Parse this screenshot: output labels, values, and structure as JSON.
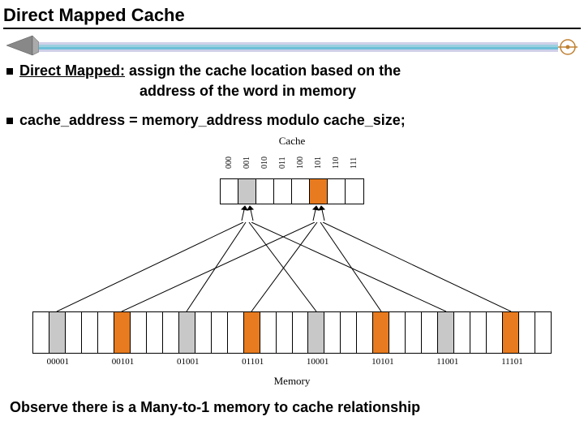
{
  "title": "Direct Mapped Cache",
  "bullets": {
    "b1_lead": "Direct Mapped:",
    "b1_rest": "  assign the cache location based on the",
    "b1_cont": "address of the word in memory",
    "b2": "cache_address =  memory_address modulo  cache_size;"
  },
  "cache": {
    "label": "Cache",
    "bits": [
      "000",
      "001",
      "010",
      "011",
      "100",
      "101",
      "110",
      "111"
    ],
    "colors": [
      "white",
      "gray",
      "white",
      "white",
      "white",
      "orange",
      "white",
      "white"
    ]
  },
  "memory": {
    "label": "Memory",
    "colors": [
      "white",
      "gray",
      "white",
      "white",
      "white",
      "orange",
      "white",
      "white",
      "white",
      "gray",
      "white",
      "white",
      "white",
      "orange",
      "white",
      "white",
      "white",
      "gray",
      "white",
      "white",
      "white",
      "orange",
      "white",
      "white",
      "white",
      "gray",
      "white",
      "white",
      "white",
      "orange",
      "white",
      "white"
    ],
    "labels": [
      "00001",
      "00101",
      "01001",
      "01101",
      "10001",
      "10101",
      "11001",
      "11101"
    ]
  },
  "footer": "Observe there is a Many-to-1 memory to cache relationship"
}
